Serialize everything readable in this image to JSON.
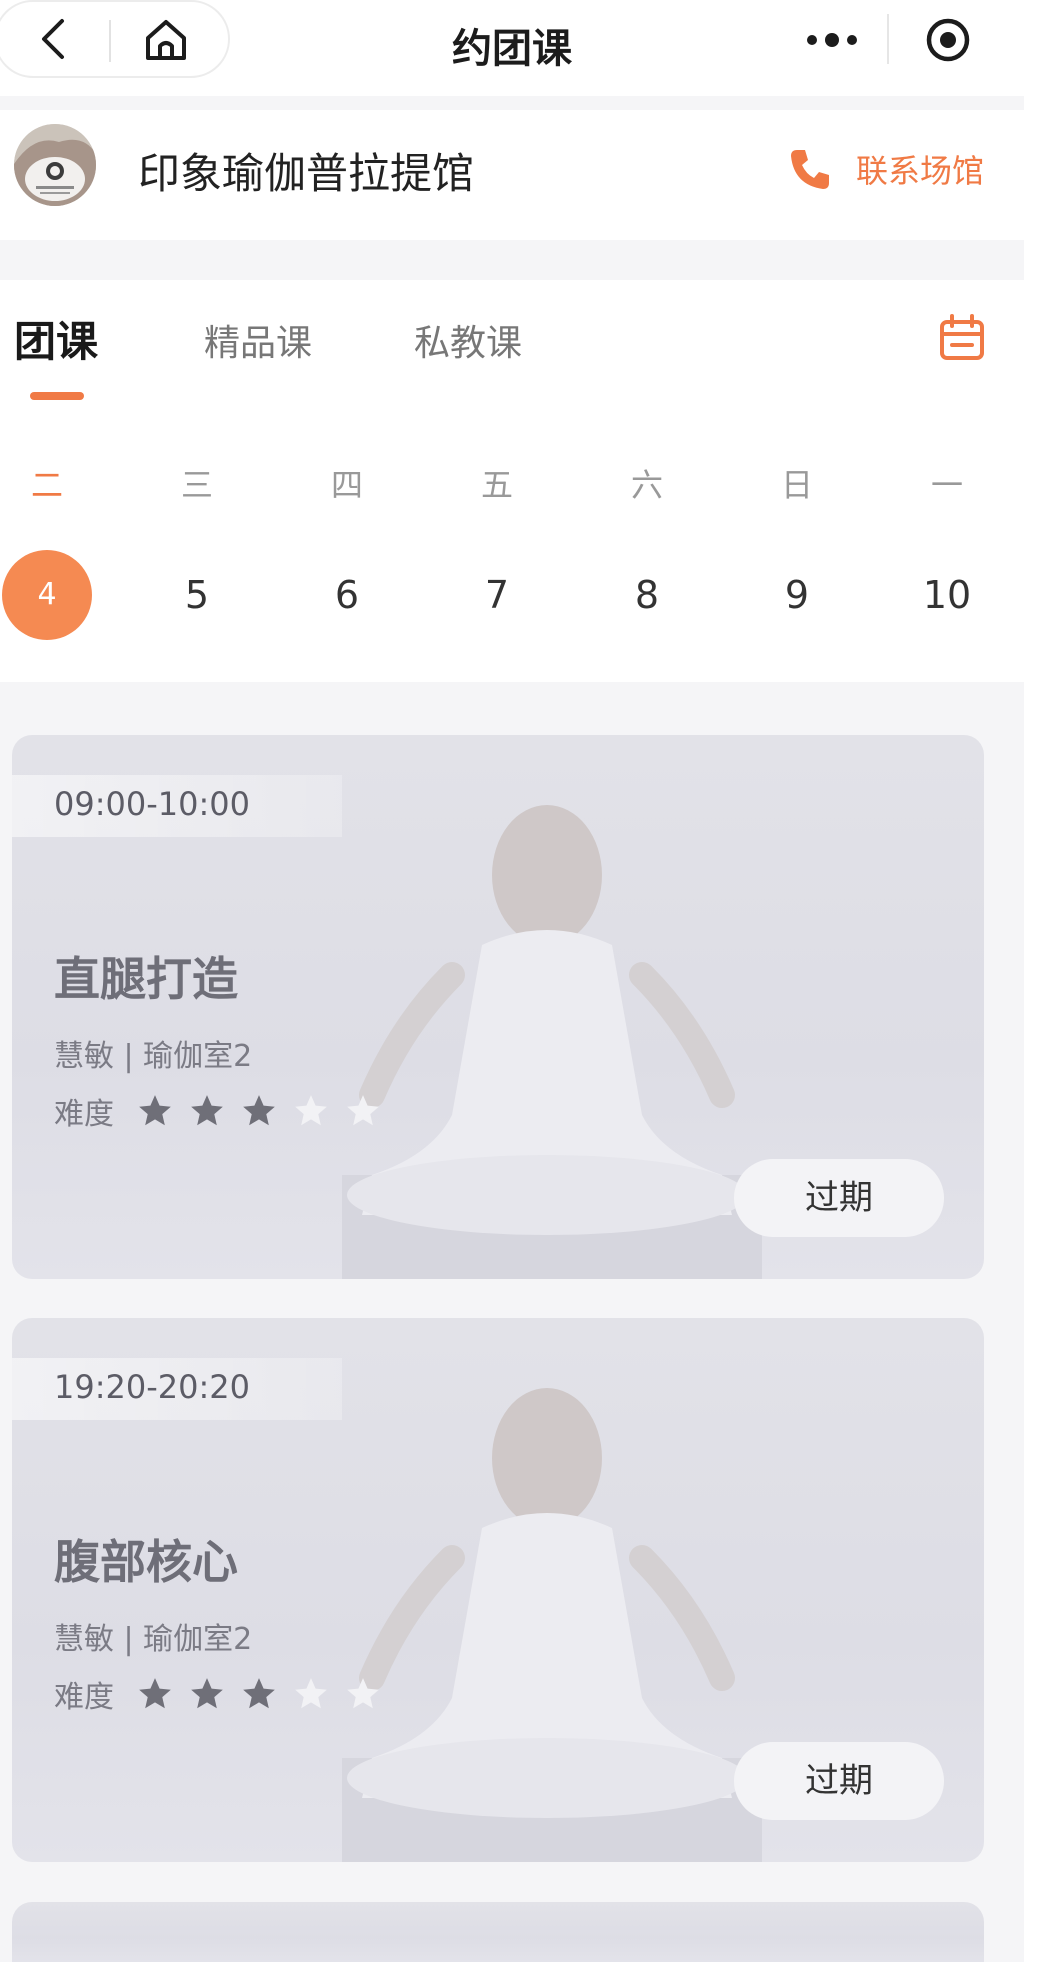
{
  "nav": {
    "title": "约团课"
  },
  "studio": {
    "name": "印象瑜伽普拉提馆",
    "contact_label": "联系场馆"
  },
  "tabs": [
    {
      "label": "团课",
      "active": true
    },
    {
      "label": "精品课",
      "active": false
    },
    {
      "label": "私教课",
      "active": false
    }
  ],
  "week": [
    {
      "weekday": "二",
      "date": "4",
      "active": true
    },
    {
      "weekday": "三",
      "date": "5",
      "active": false
    },
    {
      "weekday": "四",
      "date": "6",
      "active": false
    },
    {
      "weekday": "五",
      "date": "7",
      "active": false
    },
    {
      "weekday": "六",
      "date": "8",
      "active": false
    },
    {
      "weekday": "日",
      "date": "9",
      "active": false
    },
    {
      "weekday": "一",
      "date": "10",
      "active": false
    }
  ],
  "classes": [
    {
      "time": "09:00-10:00",
      "name": "直腿打造",
      "meta": "慧敏 | 瑜伽室2",
      "difficulty_label": "难度",
      "difficulty": 3,
      "difficulty_max": 5,
      "status": "过期"
    },
    {
      "time": "19:20-20:20",
      "name": "腹部核心",
      "meta": "慧敏 | 瑜伽室2",
      "difficulty_label": "难度",
      "difficulty": 3,
      "difficulty_max": 5,
      "status": "过期"
    }
  ],
  "colors": {
    "accent": "#f07a45",
    "accent_circle": "#f58a52"
  }
}
